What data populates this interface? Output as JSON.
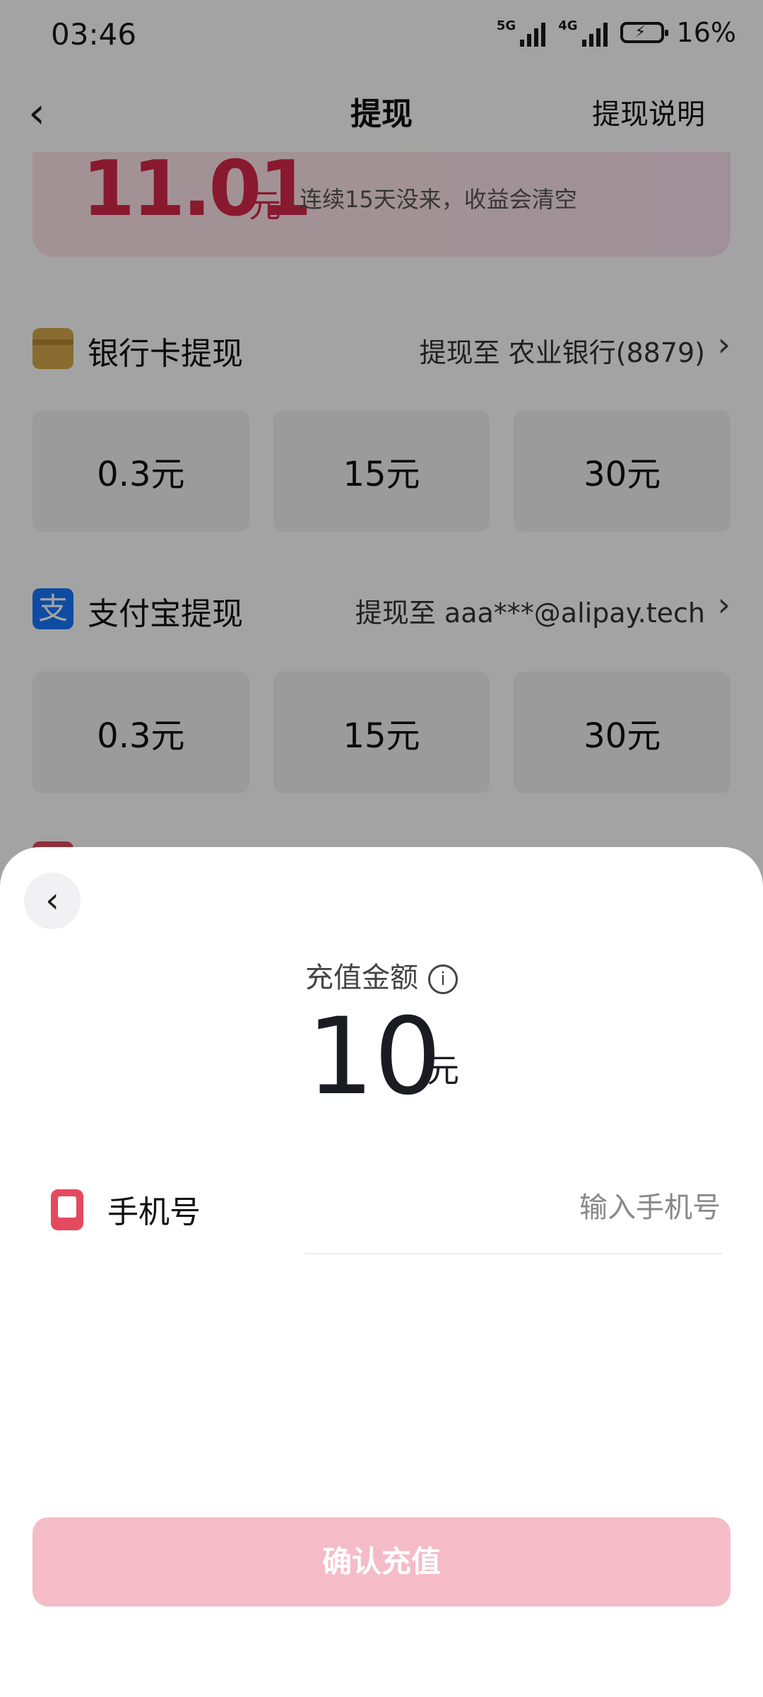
{
  "status": {
    "time": "03:46",
    "sig1": "5G",
    "sig2": "4G",
    "battery": "16%"
  },
  "nav": {
    "back": "‹",
    "title": "提现",
    "help": "提现说明"
  },
  "balance": {
    "amount": "11.01",
    "unit": "元",
    "note": "连续15天没来，收益会清空"
  },
  "bank": {
    "label": "银行卡提现",
    "dest": "提现至 农业银行(8879)",
    "chevron": "›",
    "amounts": [
      "0.3元",
      "15元",
      "30元"
    ]
  },
  "alipay": {
    "label": "支付宝提现",
    "dest": "提现至 aaa***@alipay.tech",
    "chevron": "›",
    "icon_text": "支",
    "amounts": [
      "0.3元",
      "15元",
      "30元"
    ]
  },
  "sheet": {
    "back": "‹",
    "amount_label": "充值金额",
    "info": "i",
    "amount": "10",
    "unit": "元",
    "phone_label": "手机号",
    "phone_placeholder": "输入手机号",
    "confirm": "确认充值"
  },
  "colors": {
    "accent": "#d6284a",
    "confirm_disabled": "#f5bcc8",
    "alipay": "#1677ff",
    "bank": "#d7a94a"
  },
  "icons": {
    "bank": "bank-card-icon",
    "alipay": "alipay-icon",
    "phone": "phone-icon",
    "info": "info-icon"
  }
}
